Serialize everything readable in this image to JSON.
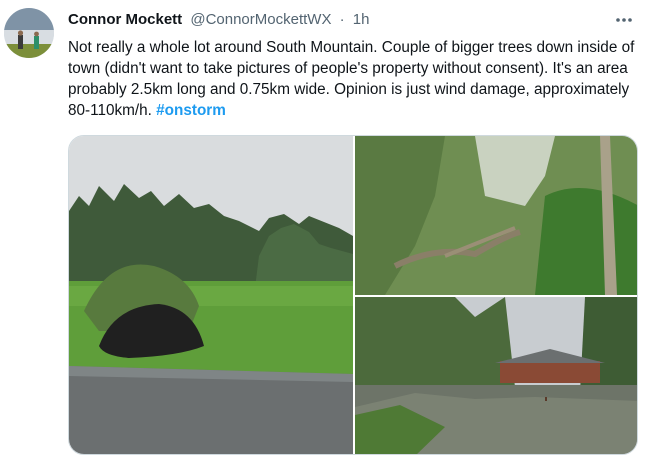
{
  "tweet": {
    "author_name": "Connor Mockett",
    "handle": "@ConnorMockettWX",
    "separator": "·",
    "time": "1h",
    "text": "Not really a whole lot around South Mountain. Couple of bigger trees down inside of town (didn't want to take pictures of people's property without consent). It's an area probably 2.5km long and 0.75km wide. Opinion is just wind damage, approximately 80-110km/h. ",
    "hashtag": "#onstorm"
  },
  "icons": {
    "more": "more-horizontal-icon"
  },
  "colors": {
    "link": "#1d9bf0",
    "secondary_text": "#536471",
    "primary_text": "#0f1419"
  }
}
